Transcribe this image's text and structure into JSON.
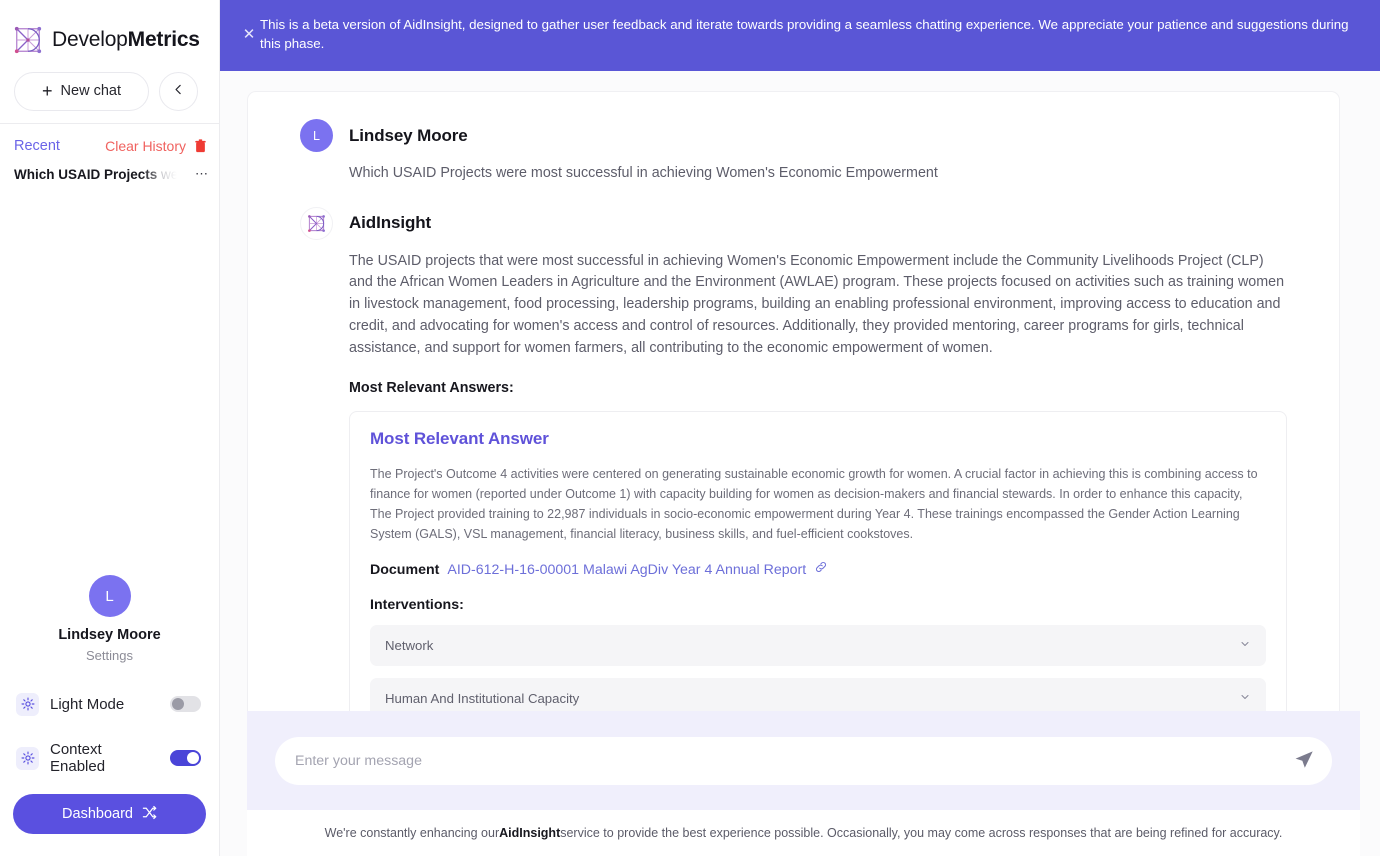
{
  "brand": {
    "name_light": "Develop",
    "name_bold": "Metrics",
    "logo_icon": "network-graph-logo-icon"
  },
  "sidebar": {
    "new_chat_label": "New chat",
    "plus_icon": "plus-icon",
    "collapse_icon": "chevron-left-icon",
    "recent_label": "Recent",
    "clear_history_label": "Clear History",
    "trash_icon": "trash-icon",
    "history": [
      {
        "text_bold": "Which USAID Projects",
        "text_faded": " were",
        "menu_icon": "ellipsis-icon"
      }
    ],
    "profile": {
      "avatar_initial": "L",
      "name": "Lindsey Moore",
      "settings_label": "Settings"
    },
    "toggles": [
      {
        "icon": "gear-icon",
        "label": "Light Mode",
        "on": false
      },
      {
        "icon": "gear-icon",
        "label": "Context Enabled",
        "on": true
      }
    ],
    "dashboard_label": "Dashboard",
    "dashboard_icon": "shuffle-icon"
  },
  "banner": {
    "close_icon": "close-icon",
    "text": "This is a beta version of AidInsight, designed to gather user feedback and iterate towards providing a seamless chatting experience. We appreciate your patience and suggestions during this phase.",
    "color": "#5a56d6"
  },
  "conversation": {
    "user": {
      "avatar_initial": "L",
      "author": "Lindsey Moore",
      "message": "Which USAID Projects were most successful in achieving Women's Economic Empowerment"
    },
    "bot": {
      "avatar_icon": "aidinsight-logo-icon",
      "author": "AidInsight",
      "message": "The USAID projects that were most successful in achieving Women's Economic Empowerment include the Community Livelihoods Project (CLP) and the African Women Leaders in Agriculture and the Environment (AWLAE) program. These projects focused on activities such as training women in livestock management, food processing, leadership programs, building an enabling professional environment, improving access to education and credit, and advocating for women's access and control of resources. Additionally, they provided mentoring, career programs for girls, technical assistance, and support for women farmers, all contributing to the economic empowerment of women.",
      "section_label": "Most Relevant Answers:"
    },
    "answer_card": {
      "title": "Most Relevant Answer",
      "body": "The Project's Outcome 4 activities were centered on generating sustainable economic growth for women. A crucial factor in achieving this is combining access to finance for women (reported under Outcome 1) with capacity building for women as decision-makers and financial stewards. In order to enhance this capacity, The Project provided training to 22,987 individuals in socio-economic empowerment during Year 4. These trainings encompassed the Gender Action Learning System (GALS), VSL management, financial literacy, business skills, and fuel-efficient cookstoves.",
      "document_label": "Document",
      "document_name": "AID-612-H-16-00001 Malawi AgDiv Year 4 Annual Report",
      "link_icon": "external-link-icon",
      "interventions_label": "Interventions:",
      "interventions": [
        {
          "label": "Network",
          "chevron": "chevron-down-icon"
        },
        {
          "label": "Human And Institutional Capacity",
          "chevron": "chevron-down-icon"
        },
        {
          "label": "",
          "chevron": "chevron-down-icon"
        }
      ]
    }
  },
  "composer": {
    "placeholder": "Enter your message",
    "value": "",
    "send_icon": "send-paper-plane-icon"
  },
  "footer": {
    "prefix": "We're constantly enhancing our ",
    "brand": "AidInsight",
    "suffix": " service to provide the best experience possible. Occasionally, you may come across responses that are being refined for accuracy."
  },
  "colors": {
    "accent": "#5a50e0",
    "banner": "#5a56d6",
    "danger": "#f0625f",
    "avatar": "#7b72f0"
  }
}
